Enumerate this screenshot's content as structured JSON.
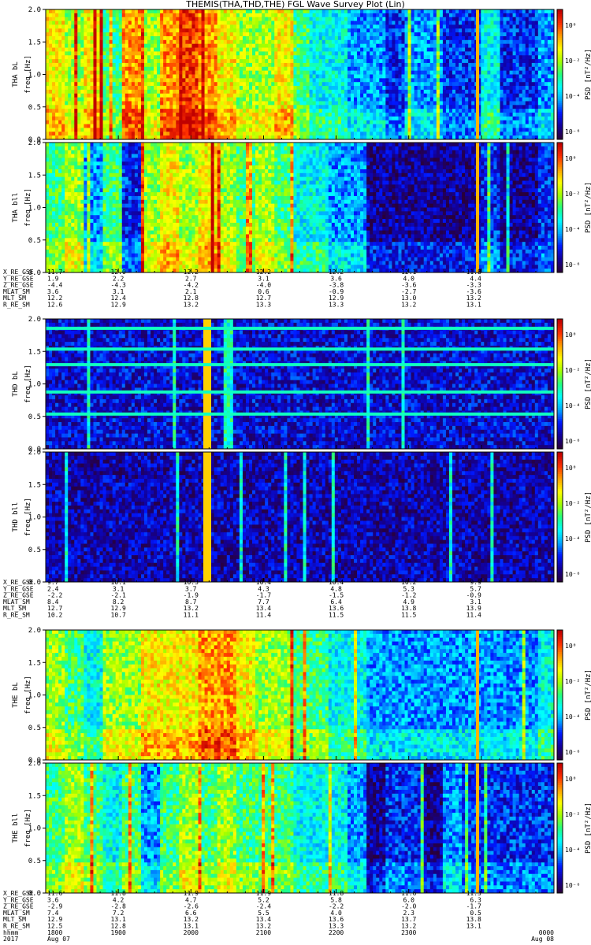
{
  "title": "THEMIS(THA,THD,THE) FGL Wave Survey Plot (Lin)",
  "colors": {
    "colorbar_stops": [
      "#2a0038",
      "#12009a",
      "#0018ff",
      "#00a8ff",
      "#00ffff",
      "#20ff80",
      "#a0ff00",
      "#ffff00",
      "#ffa000",
      "#ff3000",
      "#c00000"
    ]
  },
  "chart_data": [
    {
      "type": "heatmap",
      "probe": "THA",
      "xlabel": "hhmm",
      "x_start": "1700",
      "x_end": "0000",
      "panels": [
        {
          "name": "THA bL",
          "ylabel_probe": "THA bL",
          "ylabel": "freq [Hz]",
          "ylim": [
            0.0,
            2.0
          ],
          "yticks": [
            "0.0",
            "0.5",
            "1.0",
            "1.5",
            "2.0"
          ],
          "colorbar_label": "PSD [nT²/Hz]",
          "colorbar_ticks": [
            "10⁻⁶",
            "10⁻⁴",
            "10⁻²",
            "10⁰"
          ],
          "activity": [
            0.7,
            0.6,
            0.7,
            0.5,
            0.8,
            0.6,
            0.8,
            0.9,
            0.8,
            0.7,
            0.6,
            0.6,
            0.7,
            0.5,
            0.4,
            0.4,
            0.3,
            0.3,
            0.2,
            0.3,
            0.3,
            0.2,
            0.2,
            0.4,
            0.2,
            0.2,
            0.3
          ]
        },
        {
          "name": "THA bll",
          "ylabel_probe": "THA bll",
          "ylabel": "freq [Hz]",
          "ylim": [
            0.0,
            2.0
          ],
          "yticks": [
            "0.0",
            "0.5",
            "1.0",
            "1.5",
            "2.0"
          ],
          "colorbar_label": "PSD [nT²/Hz]",
          "colorbar_ticks": [
            "10⁻⁶",
            "10⁻⁴",
            "10⁻²",
            "10⁰"
          ],
          "activity": [
            0.5,
            0.6,
            0.3,
            0.5,
            0.2,
            0.6,
            0.7,
            0.6,
            0.7,
            0.6,
            0.5,
            0.6,
            0.5,
            0.4,
            0.4,
            0.3,
            0.3,
            0.1,
            0.1,
            0.1,
            0.1,
            0.1,
            0.1,
            0.2,
            0.1,
            0.1,
            0.2
          ]
        }
      ],
      "ephemeris": [
        {
          "label": "X_RE_GSE",
          "values": [
            "11.7",
            "12.0",
            "12.2",
            "12.2",
            "12.2",
            "12.1",
            "11.8"
          ]
        },
        {
          "label": "Y_RE_GSE",
          "values": [
            "1.9",
            "2.2",
            "2.7",
            "3.1",
            "3.6",
            "4.0",
            "4.4"
          ]
        },
        {
          "label": "Z_RE_GSE",
          "values": [
            "-4.4",
            "-4.3",
            "-4.2",
            "-4.0",
            "-3.8",
            "-3.6",
            "-3.3"
          ]
        },
        {
          "label": "MLAT_SM",
          "values": [
            "3.6",
            "3.1",
            "2.1",
            "0.6",
            "-0.9",
            "-2.7",
            "-3.6"
          ]
        },
        {
          "label": "MLT_SM",
          "values": [
            "12.2",
            "12.4",
            "12.8",
            "12.7",
            "12.9",
            "13.0",
            "13.2"
          ]
        },
        {
          "label": "R_RE_SM",
          "values": [
            "12.6",
            "12.9",
            "13.2",
            "13.3",
            "13.3",
            "13.2",
            "13.1"
          ]
        }
      ]
    },
    {
      "type": "heatmap",
      "probe": "THD",
      "xlabel": "hhmm",
      "x_start": "1700",
      "x_end": "0000",
      "panels": [
        {
          "name": "THD bL",
          "ylabel_probe": "THD bL",
          "ylabel": "freq [Hz]",
          "ylim": [
            0.0,
            2.0
          ],
          "yticks": [
            "0.0",
            "0.5",
            "1.0",
            "1.5",
            "2.0"
          ],
          "colorbar_label": "PSD [nT²/Hz]",
          "colorbar_ticks": [
            "10⁻⁶",
            "10⁻⁴",
            "10⁻²",
            "10⁰"
          ],
          "activity": [
            0.15,
            0.15,
            0.15,
            0.15,
            0.15,
            0.15,
            0.15,
            0.15,
            0.15,
            0.15,
            0.15,
            0.15,
            0.15,
            0.15,
            0.15,
            0.15,
            0.15,
            0.15,
            0.15,
            0.15,
            0.15,
            0.15,
            0.15,
            0.15,
            0.15,
            0.15,
            0.15
          ]
        },
        {
          "name": "THD bll",
          "ylabel_probe": "THD bll",
          "ylabel": "freq [Hz]",
          "ylim": [
            0.0,
            2.0
          ],
          "yticks": [
            "0.0",
            "0.5",
            "1.0",
            "1.5",
            "2.0"
          ],
          "colorbar_label": "PSD [nT²/Hz]",
          "colorbar_ticks": [
            "10⁻⁶",
            "10⁻⁴",
            "10⁻²",
            "10⁰"
          ],
          "activity": [
            0.12,
            0.12,
            0.12,
            0.12,
            0.12,
            0.12,
            0.12,
            0.12,
            0.12,
            0.12,
            0.12,
            0.12,
            0.12,
            0.12,
            0.12,
            0.12,
            0.12,
            0.12,
            0.12,
            0.12,
            0.12,
            0.12,
            0.12,
            0.12,
            0.12,
            0.12,
            0.12
          ]
        }
      ],
      "ephemeris": [
        {
          "label": "X_RE_GSE",
          "values": [
            "9.7",
            "10.1",
            "10.3",
            "10.4",
            "10.4",
            "10.2",
            "9.9"
          ]
        },
        {
          "label": "Y_RE_GSE",
          "values": [
            "2.4",
            "3.1",
            "3.7",
            "4.3",
            "4.8",
            "5.3",
            "5.7"
          ]
        },
        {
          "label": "Z_RE_GSE",
          "values": [
            "-2.2",
            "-2.1",
            "-1.9",
            "-1.7",
            "-1.5",
            "-1.2",
            "-0.9"
          ]
        },
        {
          "label": "MLAT_SM",
          "values": [
            "8.4",
            "8.2",
            "8.7",
            "7.7",
            "6.4",
            "4.9",
            "3.1"
          ]
        },
        {
          "label": "MLT_SM",
          "values": [
            "12.7",
            "12.9",
            "13.2",
            "13.4",
            "13.6",
            "13.8",
            "13.9"
          ]
        },
        {
          "label": "R_RE_SM",
          "values": [
            "10.2",
            "10.7",
            "11.1",
            "11.4",
            "11.5",
            "11.5",
            "11.4"
          ]
        }
      ]
    },
    {
      "type": "heatmap",
      "probe": "THE",
      "xlabel": "hhmm",
      "x_start": "1700",
      "x_end": "0000",
      "panels": [
        {
          "name": "THE bL",
          "ylabel_probe": "THE bL",
          "ylabel": "freq [Hz]",
          "ylim": [
            0.0,
            2.0
          ],
          "yticks": [
            "0.0",
            "0.5",
            "1.0",
            "1.5",
            "2.0"
          ],
          "colorbar_label": "PSD [nT²/Hz]",
          "colorbar_ticks": [
            "10⁻⁶",
            "10⁻⁴",
            "10⁻²",
            "10⁰"
          ],
          "activity": [
            0.6,
            0.5,
            0.4,
            0.6,
            0.6,
            0.7,
            0.7,
            0.7,
            0.8,
            0.8,
            0.7,
            0.6,
            0.6,
            0.5,
            0.5,
            0.4,
            0.4,
            0.3,
            0.3,
            0.3,
            0.3,
            0.3,
            0.3,
            0.3,
            0.3,
            0.3,
            0.4
          ]
        },
        {
          "name": "THE bll",
          "ylabel_probe": "THE bll",
          "ylabel": "freq [Hz]",
          "ylim": [
            0.0,
            2.0
          ],
          "yticks": [
            "0.0",
            "0.5",
            "1.0",
            "1.5",
            "2.0"
          ],
          "colorbar_label": "PSD [nT²/Hz]",
          "colorbar_ticks": [
            "10⁻⁶",
            "10⁻⁴",
            "10⁻²",
            "10⁰"
          ],
          "activity": [
            0.5,
            0.6,
            0.5,
            0.4,
            0.5,
            0.3,
            0.5,
            0.6,
            0.5,
            0.6,
            0.5,
            0.5,
            0.5,
            0.4,
            0.4,
            0.4,
            0.3,
            0.1,
            0.2,
            0.2,
            0.1,
            0.3,
            0.2,
            0.2,
            0.2,
            0.2,
            0.2
          ]
        }
      ],
      "ephemeris": [
        {
          "label": "X_RE_GSE",
          "values": [
            "11.6",
            "11.8",
            "11.9",
            "11.9",
            "11.8",
            "11.6",
            "11.3"
          ]
        },
        {
          "label": "Y_RE_GSE",
          "values": [
            "3.6",
            "4.2",
            "4.7",
            "5.2",
            "5.8",
            "6.0",
            "6.3"
          ]
        },
        {
          "label": "Z_RE_GSE",
          "values": [
            "-2.9",
            "-2.8",
            "-2.6",
            "-2.4",
            "-2.2",
            "-2.0",
            "-1.7"
          ]
        },
        {
          "label": "MLAT_SM",
          "values": [
            "7.4",
            "7.2",
            "6.6",
            "5.5",
            "4.0",
            "2.3",
            "0.5"
          ]
        },
        {
          "label": "MLT_SM",
          "values": [
            "12.9",
            "13.1",
            "13.2",
            "13.4",
            "13.6",
            "13.7",
            "13.8"
          ]
        },
        {
          "label": "R_RE_SM",
          "values": [
            "12.5",
            "12.8",
            "13.1",
            "13.2",
            "13.3",
            "13.2",
            "13.1"
          ]
        }
      ],
      "time_rows": [
        {
          "label": "hhmm",
          "values": [
            "1800",
            "1900",
            "2000",
            "2100",
            "2200",
            "2300",
            "0000"
          ]
        },
        {
          "label": "2017",
          "values": [
            "Aug 07",
            "",
            "",
            "",
            "",
            "",
            "Aug 08"
          ]
        }
      ]
    }
  ]
}
